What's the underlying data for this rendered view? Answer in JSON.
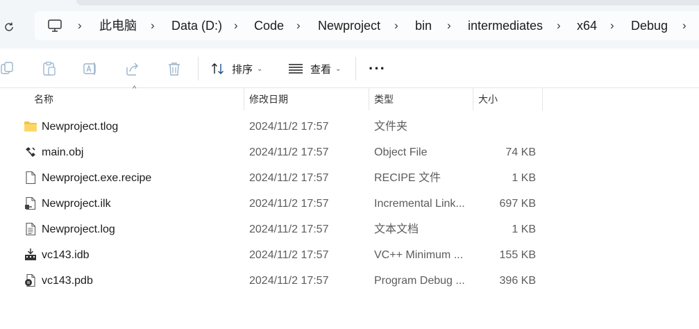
{
  "breadcrumb": [
    "此电脑",
    "Data (D:)",
    "Code",
    "Newproject",
    "bin",
    "intermediates",
    "x64",
    "Debug"
  ],
  "toolbar": {
    "sort_label": "排序",
    "view_label": "查看",
    "more_label": "···"
  },
  "columns": {
    "name": "名称",
    "date": "修改日期",
    "type": "类型",
    "size": "大小"
  },
  "files": [
    {
      "name": "Newproject.tlog",
      "date": "2024/11/2 17:57",
      "type": "文件夹",
      "size": "",
      "icon": "folder-icon"
    },
    {
      "name": "main.obj",
      "date": "2024/11/2 17:57",
      "type": "Object File",
      "size": "74 KB",
      "icon": "object-file-icon"
    },
    {
      "name": "Newproject.exe.recipe",
      "date": "2024/11/2 17:57",
      "type": "RECIPE 文件",
      "size": "1 KB",
      "icon": "blank-file-icon"
    },
    {
      "name": "Newproject.ilk",
      "date": "2024/11/2 17:57",
      "type": "Incremental Link...",
      "size": "697 KB",
      "icon": "linker-file-icon"
    },
    {
      "name": "Newproject.log",
      "date": "2024/11/2 17:57",
      "type": "文本文档",
      "size": "1 KB",
      "icon": "text-file-icon"
    },
    {
      "name": "vc143.idb",
      "date": "2024/11/2 17:57",
      "type": "VC++ Minimum ...",
      "size": "155 KB",
      "icon": "database-file-icon"
    },
    {
      "name": "vc143.pdb",
      "date": "2024/11/2 17:57",
      "type": "Program Debug ...",
      "size": "396 KB",
      "icon": "debug-database-icon"
    }
  ],
  "colors": {
    "folder": "#f5c244",
    "address_bg": "#fbfcfd",
    "chrome_bg": "#f3f6f9",
    "disabled_icon": "#9ab3cc"
  }
}
